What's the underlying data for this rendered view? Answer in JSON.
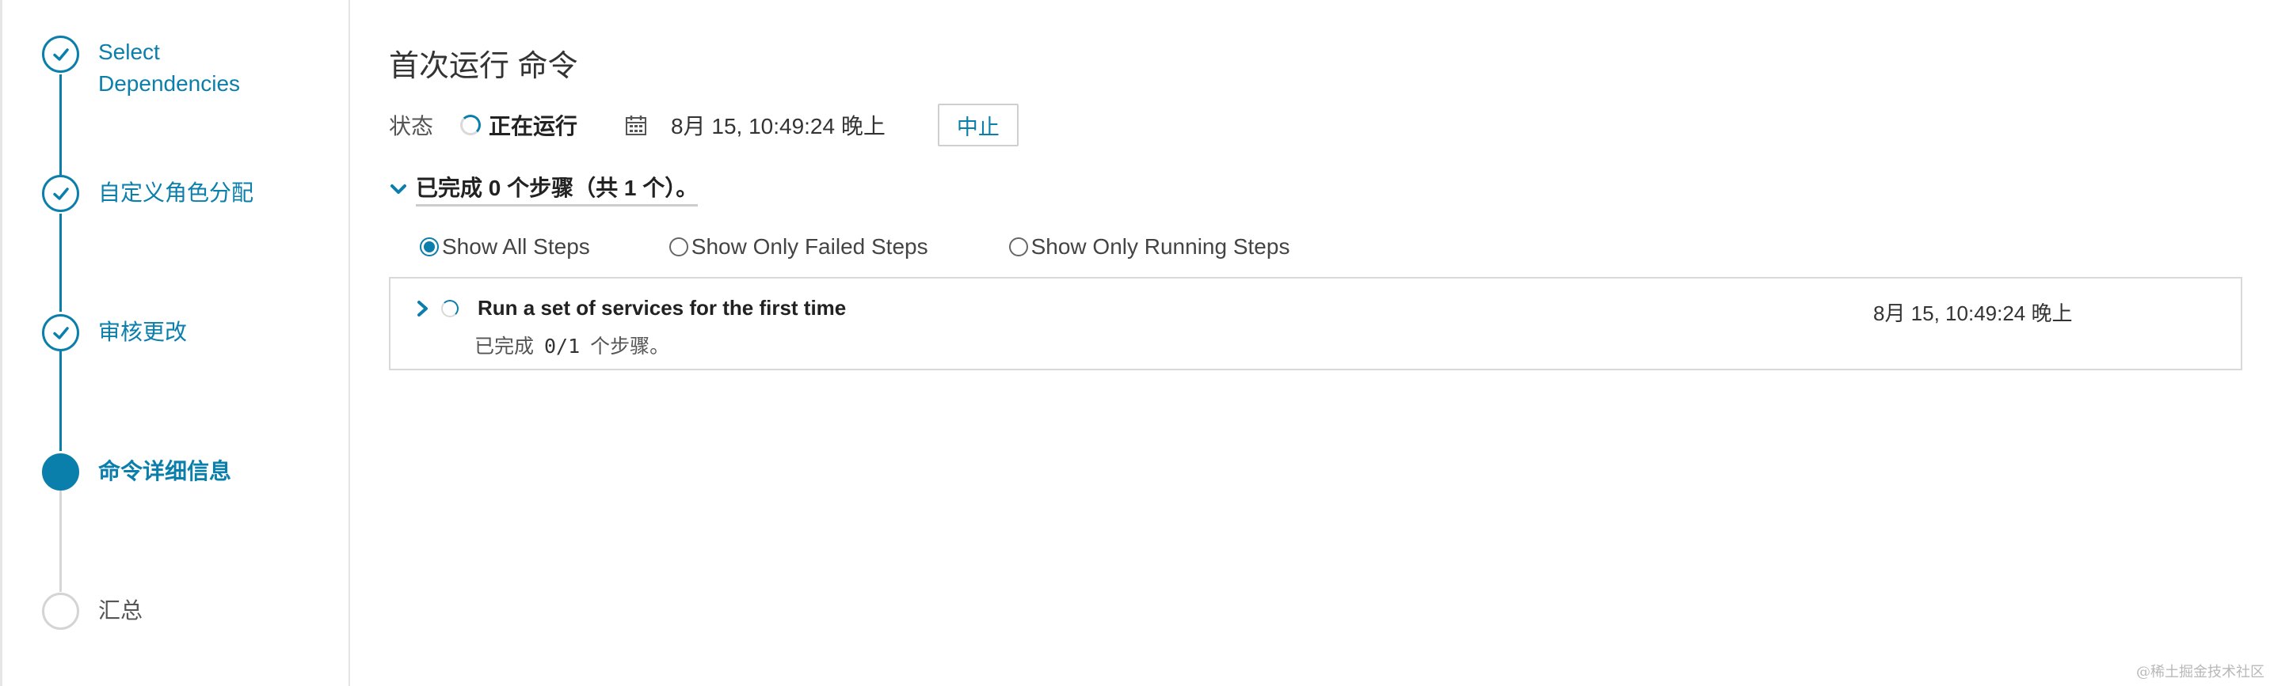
{
  "wizard": {
    "steps": [
      {
        "label": "Select Dependencies",
        "state": "done"
      },
      {
        "label": "自定义角色分配",
        "state": "done"
      },
      {
        "label": "审核更改",
        "state": "done"
      },
      {
        "label": "命令详细信息",
        "state": "active"
      },
      {
        "label": "汇总",
        "state": "todo"
      }
    ]
  },
  "main": {
    "title": "首次运行 命令",
    "status": {
      "label": "状态",
      "value": "正在运行",
      "time": "8月 15, 10:49:24 晚上",
      "abort_label": "中止"
    },
    "summary": "已完成 0 个步骤（共 1 个）。",
    "filters": [
      {
        "label": "Show All Steps",
        "checked": true
      },
      {
        "label": "Show Only Failed Steps",
        "checked": false
      },
      {
        "label": "Show Only Running Steps",
        "checked": false
      }
    ],
    "step_items": [
      {
        "title": "Run a set of services for the first time",
        "time": "8月 15, 10:49:24 晚上",
        "progress_prefix": "已完成",
        "progress_count": "0/1",
        "progress_suffix": "个步骤。"
      }
    ]
  },
  "watermark": "@稀土掘金技术社区",
  "colors": {
    "accent": "#0b7fab",
    "line_todo": "#d6d6d6",
    "border": "#d9d9d9"
  },
  "icons": {
    "check": "check-icon",
    "spinner": "spinner-icon",
    "calendar": "calendar-icon",
    "chevron_down": "chevron-down-icon",
    "chevron_right": "chevron-right-icon"
  }
}
